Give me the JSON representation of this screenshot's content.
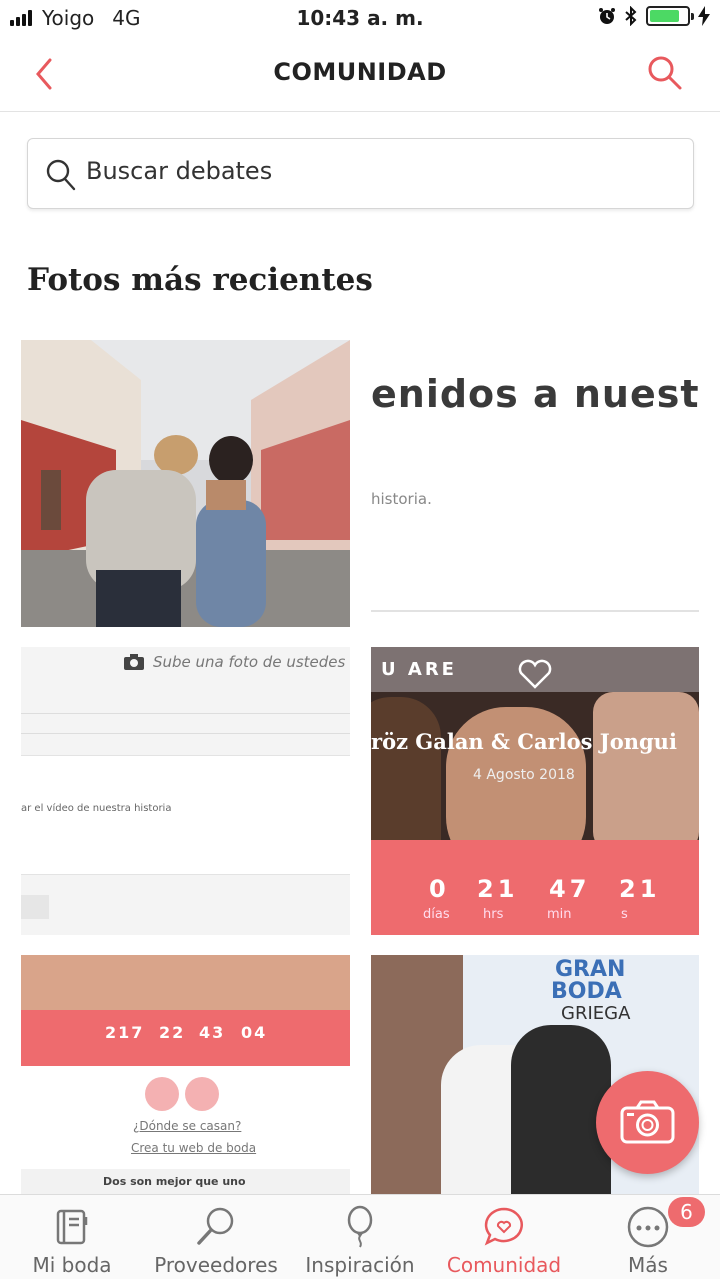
{
  "status": {
    "carrier": "Yoigo",
    "network": "4G",
    "time": "10:43 a. m."
  },
  "header": {
    "title": "COMUNIDAD"
  },
  "search": {
    "placeholder": "Buscar debates"
  },
  "section": {
    "title": "Fotos más recientes"
  },
  "photos": {
    "p2": {
      "headline": "enidos a nuest",
      "sub": "historia."
    },
    "p3": {
      "caption": "Sube una foto de ustedes",
      "line": "ar el vídeo de nuestra historia"
    },
    "p4": {
      "label": "U ARE",
      "names": "röz Galan & Carlos Jongui",
      "date": "4 Agosto 2018",
      "countdown": [
        "0",
        "21",
        "47",
        "21"
      ],
      "units": [
        "días",
        "hrs",
        "min",
        "s"
      ]
    },
    "p5": {
      "countdown": [
        "217",
        "22",
        "43",
        "04"
      ],
      "link1": "¿Dónde se casan?",
      "link2": "Crea tu web de boda",
      "footer": "Dos son mejor que uno"
    },
    "p6": {
      "title1": "GRAN",
      "title2": "BODA",
      "title3": "GRIEGA"
    }
  },
  "tabs": [
    {
      "label": "Mi boda",
      "icon": "notebook-icon"
    },
    {
      "label": "Proveedores",
      "icon": "magnifier-icon"
    },
    {
      "label": "Inspiración",
      "icon": "balloon-icon"
    },
    {
      "label": "Comunidad",
      "icon": "chat-heart-icon"
    },
    {
      "label": "Más",
      "icon": "more-icon"
    }
  ],
  "badge": {
    "count": "6"
  },
  "colors": {
    "accent": "#ee6b6e",
    "active_tab": "#e8595d",
    "battery": "#4cd964"
  }
}
